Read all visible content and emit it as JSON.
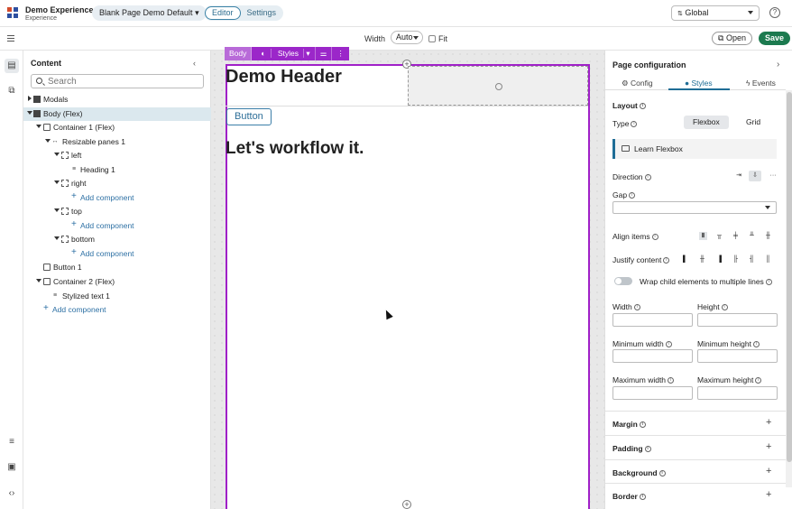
{
  "app": {
    "name": "Demo Experience",
    "subtitle": "Experience",
    "page_select": "Blank Page Demo Default",
    "mode_tabs": [
      "Editor",
      "Settings"
    ],
    "scope_select": "Global",
    "help_label": "?"
  },
  "toolbar": {
    "width_label": "Width",
    "width_value": "Auto",
    "fit_label": "Fit",
    "open_label": "Open",
    "save_label": "Save"
  },
  "content_panel": {
    "title": "Content",
    "search_placeholder": "Search",
    "tree": [
      {
        "label": "Modals",
        "type": "item"
      },
      {
        "label": "Body (Flex)",
        "type": "item"
      },
      {
        "label": "Container 1 (Flex)",
        "type": "item"
      },
      {
        "label": "Resizable panes 1",
        "type": "item"
      },
      {
        "label": "left",
        "type": "item"
      },
      {
        "label": "Heading 1",
        "type": "item"
      },
      {
        "label": "right",
        "type": "item"
      },
      {
        "label": "Add component",
        "type": "add"
      },
      {
        "label": "top",
        "type": "item"
      },
      {
        "label": "Add component",
        "type": "add"
      },
      {
        "label": "bottom",
        "type": "item"
      },
      {
        "label": "Add component",
        "type": "add"
      },
      {
        "label": "Button 1",
        "type": "item"
      },
      {
        "label": "Container 2 (Flex)",
        "type": "item"
      },
      {
        "label": "Stylized text 1",
        "type": "item"
      },
      {
        "label": "Add component",
        "type": "add"
      }
    ]
  },
  "canvas": {
    "body_tag": "Body",
    "styles_label": "Styles",
    "heading": "Demo Header",
    "button": "Button",
    "stylized_text": "Let's workflow it."
  },
  "config": {
    "title": "Page configuration",
    "tabs": [
      "Config",
      "Styles",
      "Events"
    ],
    "active_tab": "Styles",
    "layout_label": "Layout",
    "type_label": "Type",
    "type_options": [
      "Flexbox",
      "Grid"
    ],
    "type_selected": "Flexbox",
    "learn_label": "Learn Flexbox",
    "direction_label": "Direction",
    "gap_label": "Gap",
    "align_label": "Align items",
    "justify_label": "Justify content",
    "wrap_label": "Wrap child elements to multiple lines",
    "width_label": "Width",
    "height_label": "Height",
    "min_width_label": "Minimum width",
    "min_height_label": "Minimum height",
    "max_width_label": "Maximum width",
    "max_height_label": "Maximum height",
    "sections": [
      "Margin",
      "Padding",
      "Background",
      "Border"
    ]
  },
  "icons": {
    "logo": "app-logo-icon",
    "search": "search-icon",
    "add": "plus-icon",
    "info": "info-icon"
  },
  "colors": {
    "accent": "#1f6d96",
    "selection_frame": "#a020c8",
    "save_button": "#1c7a4f"
  }
}
